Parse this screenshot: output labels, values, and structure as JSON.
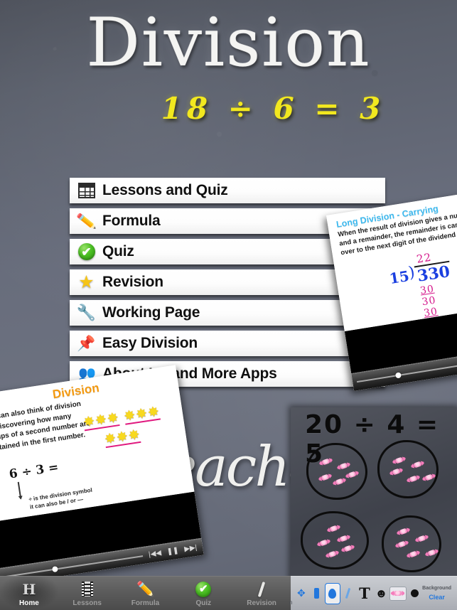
{
  "app": {
    "title": "Division",
    "equation": "18 ÷ 6 = 3",
    "watermark": "Teacher"
  },
  "menu": {
    "items": [
      {
        "label": "Lessons and Quiz",
        "icon": "film-strip-icon"
      },
      {
        "label": "Formula",
        "icon": "pencil-icon"
      },
      {
        "label": "Quiz",
        "icon": "green-check-icon"
      },
      {
        "label": "Revision",
        "icon": "star-icon"
      },
      {
        "label": "Working Page",
        "icon": "wrench-icon"
      },
      {
        "label": "Easy Division",
        "icon": "pushpin-icon"
      },
      {
        "label": "About Us and More Apps",
        "icon": "people-group-icon"
      }
    ]
  },
  "long_division_card": {
    "title": "Long Division - Carrying",
    "body": "When the result of division gives a number and a remainder, the remainder is carried over to the next digit of the dividend",
    "quotient": "22",
    "divisor": "15",
    "dividend": "330",
    "step1": "30",
    "step2": "30",
    "step3": "30",
    "controls": {
      "prev": "|◀◀",
      "pause": "❚❚",
      "next": "▶▶|"
    }
  },
  "division_card": {
    "title": "Division",
    "body": "You can also think of division as, discovering how many groups of a second number are contained in the first number.",
    "equation": "6 ÷ 3 =",
    "note_line1": "÷ is the division symbol",
    "note_line2": "it can also be / or —",
    "star_groups": [
      3,
      3,
      3
    ],
    "controls": {
      "prev": "|◀◀",
      "pause": "❚❚",
      "next": "▶▶|"
    }
  },
  "whiteboard": {
    "equation": "20 ÷ 4 = 5",
    "groups": 4,
    "candies_per_group": 5
  },
  "tabbar": {
    "tabs": [
      {
        "label": "Home",
        "icon": "home-icon",
        "active": true
      },
      {
        "label": "Lessons",
        "icon": "film-reel-icon",
        "active": false
      },
      {
        "label": "Formula",
        "icon": "pencil-icon",
        "active": false
      },
      {
        "label": "Quiz",
        "icon": "green-check-icon",
        "active": false
      },
      {
        "label": "Revision",
        "icon": "chalk-stroke-icon",
        "active": false
      }
    ]
  },
  "drawbar": {
    "tools": [
      {
        "name": "move-tool",
        "icon": "move-arrows-icon",
        "selected": false
      },
      {
        "name": "rectangle-tool",
        "icon": "rectangle-icon",
        "selected": false
      },
      {
        "name": "shape-tool",
        "icon": "droplet-shape-icon",
        "selected": true
      },
      {
        "name": "pen-tool",
        "icon": "pen-icon",
        "selected": false
      },
      {
        "name": "text-tool",
        "icon": "text-t-icon",
        "selected": false
      },
      {
        "name": "stamp-tool",
        "icon": "stamp-icon",
        "selected": false
      },
      {
        "name": "candy-stamp-tool",
        "icon": "candy-icon",
        "selected": false
      },
      {
        "name": "dot-tool",
        "icon": "filled-dot-icon",
        "selected": false
      }
    ],
    "background_label": "Background",
    "clear_label": "Clear"
  },
  "colors": {
    "chalkboard": "#6d7280",
    "accent_yellow": "#f2e81f",
    "card_blue": "#3cb9ef",
    "card_orange": "#f39a12",
    "ink_blue": "#1a3fe0",
    "ink_pink": "#d51a8c",
    "tool_blue": "#2277dd"
  }
}
